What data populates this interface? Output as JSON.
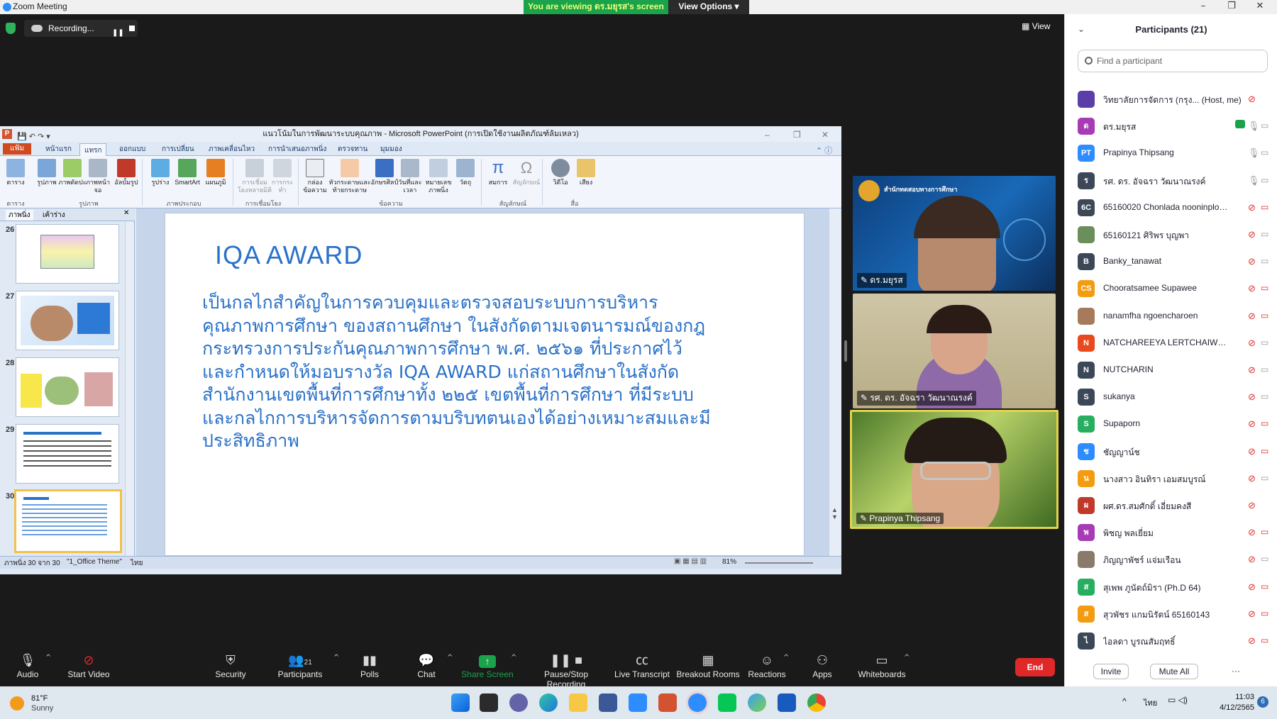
{
  "window": {
    "title": "Zoom Meeting"
  },
  "banner": {
    "viewing": "You are viewing ดร.มยุรส's screen",
    "view_options": "View Options"
  },
  "recording": {
    "label": "Recording..."
  },
  "view_button": "View",
  "powerpoint": {
    "title": "แนวโน้มในการพัฒนาระบบคุณภาพ - Microsoft PowerPoint (การเปิดใช้งานผลิตภัณฑ์ล้มเหลว)",
    "tabs": [
      "แฟ้ม",
      "หน้าแรก",
      "แทรก",
      "ออกแบบ",
      "การเปลี่ยน",
      "ภาพเคลื่อนไหว",
      "การนำเสนอภาพนิ่ง",
      "ตรวจทาน",
      "มุมมอง"
    ],
    "ribbon": [
      {
        "label": "ตาราง"
      },
      {
        "label": "รูปภาพ"
      },
      {
        "label": "ภาพตัดปะ"
      },
      {
        "label": "ภาพหน้าจอ"
      },
      {
        "label": "อัลบั้มรูป"
      },
      {
        "label": "รูปร่าง"
      },
      {
        "label": "SmartArt"
      },
      {
        "label": "แผนภูมิ"
      },
      {
        "label": "การเชื่อมโยงหลายมิติ"
      },
      {
        "label": "การกระทำ"
      },
      {
        "label": "กล่องข้อความ"
      },
      {
        "label": "หัวกระดาษและท้ายกระดาษ"
      },
      {
        "label": "อักษรศิลป์"
      },
      {
        "label": "วันที่และเวลา"
      },
      {
        "label": "หมายเลขภาพนิ่ง"
      },
      {
        "label": "วัตถุ"
      },
      {
        "label": "สมการ"
      },
      {
        "label": "สัญลักษณ์"
      },
      {
        "label": "วิดีโอ"
      },
      {
        "label": "เสียง"
      }
    ],
    "groups": [
      "ตาราง",
      "รูปภาพ",
      "ภาพประกอบ",
      "การเชื่อมโยง",
      "ข้อความ",
      "สัญลักษณ์",
      "สื่อ"
    ],
    "panel_tabs": [
      "ภาพนิ่ง",
      "เค้าร่าง"
    ],
    "slide_numbers": [
      "26",
      "27",
      "28",
      "29",
      "30"
    ],
    "slide": {
      "title": "IQA AWARD",
      "body": "เป็นกลไกสำคัญในการควบคุมและตรวจสอบระบบการบริหารคุณภาพการศึกษา ของสถานศึกษา ในสังกัดตามเจตนารมณ์ของกฎกระทรวงการประกันคุณภาพการศึกษา พ.ศ. ๒๕๖๑ ที่ประกาศไว้ และกำหนดให้มอบรางวัล IQA AWARD แก่สถานศึกษาในสังกัดสำนักงานเขตพื้นที่การศึกษาทั้ง ๒๒๕ เขตพื้นที่การศึกษา ที่มีระบบและกลไกการบริหารจัดการตามบริบทตนเองได้อย่างเหมาะสมและมีประสิทธิภาพ"
    },
    "status": {
      "slide": "ภาพนิ่ง 30 จาก 30",
      "theme": "\"1_Office Theme\"",
      "lang": "ไทย",
      "zoom": "81%"
    }
  },
  "videos": [
    {
      "name": "ดร.มยุรส",
      "caption": "สำนักทดสอบทางการศึกษา"
    },
    {
      "name": "รศ. ดร. อัจฉรา วัฒนาณรงค์"
    },
    {
      "name": "Prapinya  Thipsang"
    }
  ],
  "participants_panel": {
    "title": "Participants (21)",
    "search_placeholder": "Find a participant",
    "participants": [
      {
        "name": "วิทยาลัยการจัดการ (กรุง...",
        "suffix": "(Host, me)",
        "initials": "",
        "color": "#5b3fa8"
      },
      {
        "name": "ดร.มยุรส",
        "initials": "ด",
        "color": "#a63bb5"
      },
      {
        "name": "Prapinya  Thipsang",
        "initials": "PT",
        "color": "#2d8cff"
      },
      {
        "name": "รศ. ดร. อัจฉรา วัฒนาณรงค์",
        "initials": "ร",
        "color": "#3c4858"
      },
      {
        "name": "65160020 Chonlada nooninplod...",
        "initials": "6C",
        "color": "#3c4858"
      },
      {
        "name": "65160121 ศิริพร  บุญพา",
        "initials": "",
        "color": "#6b8e5a"
      },
      {
        "name": "Banky_tanawat",
        "initials": "B",
        "color": "#3c4858"
      },
      {
        "name": "Chooratsamee Supawee",
        "initials": "CS",
        "color": "#f39c12"
      },
      {
        "name": "nanamfha ngoencharoen",
        "initials": "",
        "color": "#a67b5b"
      },
      {
        "name": "NATCHAREEYA LERTCHAIWEERA...",
        "initials": "N",
        "color": "#e8491d"
      },
      {
        "name": "NUTCHARIN",
        "initials": "N",
        "color": "#3c4858"
      },
      {
        "name": "sukanya",
        "initials": "S",
        "color": "#3c4858"
      },
      {
        "name": "Supaporn",
        "initials": "S",
        "color": "#27ae60"
      },
      {
        "name": "ชัญญาน์ช",
        "initials": "ช",
        "color": "#2d8cff"
      },
      {
        "name": "นางสาว อินทิรา เอมสมบูรณ์",
        "initials": "น",
        "color": "#f39c12"
      },
      {
        "name": "ผศ.ดร.สมศักดิ์ เอี่ยมคงสี",
        "initials": "ผ",
        "color": "#c0392b"
      },
      {
        "name": "พิชญ พลเยี่ยม",
        "initials": "พ",
        "color": "#a63bb5"
      },
      {
        "name": "ภิญญาพัชร์ แจ่มเรือน",
        "initials": "",
        "color": "#8a7a6a"
      },
      {
        "name": "สุเพพ ภูนัตถ์มิรา (Ph.D 64)",
        "initials": "ส",
        "color": "#27ae60"
      },
      {
        "name": "สุวพัชร แกมนิรัตน์ 65160143",
        "initials": "ส",
        "color": "#f39c12"
      },
      {
        "name": "ไอลดา บูรณสัมฤทธิ์",
        "initials": "ไ",
        "color": "#3c4858"
      }
    ],
    "invite": "Invite",
    "mute_all": "Mute All",
    "more": "···"
  },
  "toolbar": {
    "audio": "Audio",
    "start_video": "Start Video",
    "security": "Security",
    "participants": "Participants",
    "participants_count": "21",
    "polls": "Polls",
    "chat": "Chat",
    "share_screen": "Share Screen",
    "pause_stop": "Pause/Stop Recording",
    "live_transcript": "Live Transcript",
    "breakout_rooms": "Breakout Rooms",
    "reactions": "Reactions",
    "apps": "Apps",
    "whiteboards": "Whiteboards",
    "end": "End"
  },
  "taskbar": {
    "temp": "81°F",
    "weather": "Sunny",
    "lang": "ไทย",
    "time": "11:03",
    "date": "4/12/2565",
    "notif": "6"
  },
  "colors": {
    "accent": "#2d8cff",
    "end": "#e02828",
    "share": "#1aa34a",
    "slide_text": "#2a71c8"
  }
}
